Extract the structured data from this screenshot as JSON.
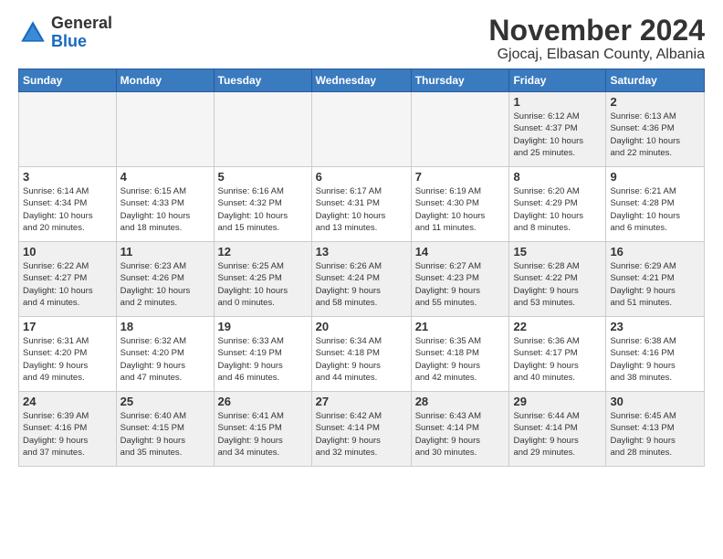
{
  "logo": {
    "general": "General",
    "blue": "Blue"
  },
  "title": "November 2024",
  "location": "Gjocaj, Elbasan County, Albania",
  "weekdays": [
    "Sunday",
    "Monday",
    "Tuesday",
    "Wednesday",
    "Thursday",
    "Friday",
    "Saturday"
  ],
  "weeks": [
    [
      {
        "day": "",
        "info": "",
        "empty": true
      },
      {
        "day": "",
        "info": "",
        "empty": true
      },
      {
        "day": "",
        "info": "",
        "empty": true
      },
      {
        "day": "",
        "info": "",
        "empty": true
      },
      {
        "day": "",
        "info": "",
        "empty": true
      },
      {
        "day": "1",
        "info": "Sunrise: 6:12 AM\nSunset: 4:37 PM\nDaylight: 10 hours\nand 25 minutes."
      },
      {
        "day": "2",
        "info": "Sunrise: 6:13 AM\nSunset: 4:36 PM\nDaylight: 10 hours\nand 22 minutes."
      }
    ],
    [
      {
        "day": "3",
        "info": "Sunrise: 6:14 AM\nSunset: 4:34 PM\nDaylight: 10 hours\nand 20 minutes."
      },
      {
        "day": "4",
        "info": "Sunrise: 6:15 AM\nSunset: 4:33 PM\nDaylight: 10 hours\nand 18 minutes."
      },
      {
        "day": "5",
        "info": "Sunrise: 6:16 AM\nSunset: 4:32 PM\nDaylight: 10 hours\nand 15 minutes."
      },
      {
        "day": "6",
        "info": "Sunrise: 6:17 AM\nSunset: 4:31 PM\nDaylight: 10 hours\nand 13 minutes."
      },
      {
        "day": "7",
        "info": "Sunrise: 6:19 AM\nSunset: 4:30 PM\nDaylight: 10 hours\nand 11 minutes."
      },
      {
        "day": "8",
        "info": "Sunrise: 6:20 AM\nSunset: 4:29 PM\nDaylight: 10 hours\nand 8 minutes."
      },
      {
        "day": "9",
        "info": "Sunrise: 6:21 AM\nSunset: 4:28 PM\nDaylight: 10 hours\nand 6 minutes."
      }
    ],
    [
      {
        "day": "10",
        "info": "Sunrise: 6:22 AM\nSunset: 4:27 PM\nDaylight: 10 hours\nand 4 minutes."
      },
      {
        "day": "11",
        "info": "Sunrise: 6:23 AM\nSunset: 4:26 PM\nDaylight: 10 hours\nand 2 minutes."
      },
      {
        "day": "12",
        "info": "Sunrise: 6:25 AM\nSunset: 4:25 PM\nDaylight: 10 hours\nand 0 minutes."
      },
      {
        "day": "13",
        "info": "Sunrise: 6:26 AM\nSunset: 4:24 PM\nDaylight: 9 hours\nand 58 minutes."
      },
      {
        "day": "14",
        "info": "Sunrise: 6:27 AM\nSunset: 4:23 PM\nDaylight: 9 hours\nand 55 minutes."
      },
      {
        "day": "15",
        "info": "Sunrise: 6:28 AM\nSunset: 4:22 PM\nDaylight: 9 hours\nand 53 minutes."
      },
      {
        "day": "16",
        "info": "Sunrise: 6:29 AM\nSunset: 4:21 PM\nDaylight: 9 hours\nand 51 minutes."
      }
    ],
    [
      {
        "day": "17",
        "info": "Sunrise: 6:31 AM\nSunset: 4:20 PM\nDaylight: 9 hours\nand 49 minutes."
      },
      {
        "day": "18",
        "info": "Sunrise: 6:32 AM\nSunset: 4:20 PM\nDaylight: 9 hours\nand 47 minutes."
      },
      {
        "day": "19",
        "info": "Sunrise: 6:33 AM\nSunset: 4:19 PM\nDaylight: 9 hours\nand 46 minutes."
      },
      {
        "day": "20",
        "info": "Sunrise: 6:34 AM\nSunset: 4:18 PM\nDaylight: 9 hours\nand 44 minutes."
      },
      {
        "day": "21",
        "info": "Sunrise: 6:35 AM\nSunset: 4:18 PM\nDaylight: 9 hours\nand 42 minutes."
      },
      {
        "day": "22",
        "info": "Sunrise: 6:36 AM\nSunset: 4:17 PM\nDaylight: 9 hours\nand 40 minutes."
      },
      {
        "day": "23",
        "info": "Sunrise: 6:38 AM\nSunset: 4:16 PM\nDaylight: 9 hours\nand 38 minutes."
      }
    ],
    [
      {
        "day": "24",
        "info": "Sunrise: 6:39 AM\nSunset: 4:16 PM\nDaylight: 9 hours\nand 37 minutes."
      },
      {
        "day": "25",
        "info": "Sunrise: 6:40 AM\nSunset: 4:15 PM\nDaylight: 9 hours\nand 35 minutes."
      },
      {
        "day": "26",
        "info": "Sunrise: 6:41 AM\nSunset: 4:15 PM\nDaylight: 9 hours\nand 34 minutes."
      },
      {
        "day": "27",
        "info": "Sunrise: 6:42 AM\nSunset: 4:14 PM\nDaylight: 9 hours\nand 32 minutes."
      },
      {
        "day": "28",
        "info": "Sunrise: 6:43 AM\nSunset: 4:14 PM\nDaylight: 9 hours\nand 30 minutes."
      },
      {
        "day": "29",
        "info": "Sunrise: 6:44 AM\nSunset: 4:14 PM\nDaylight: 9 hours\nand 29 minutes."
      },
      {
        "day": "30",
        "info": "Sunrise: 6:45 AM\nSunset: 4:13 PM\nDaylight: 9 hours\nand 28 minutes."
      }
    ]
  ]
}
